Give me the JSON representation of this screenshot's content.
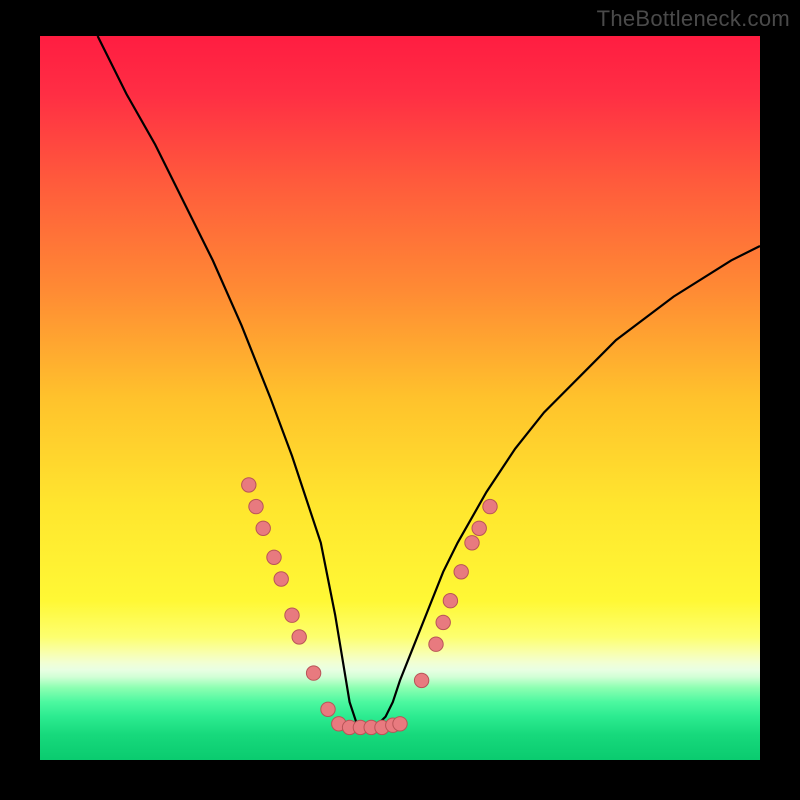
{
  "watermark": "TheBottleneck.com",
  "colors": {
    "gradient_stops": [
      {
        "offset": 0.0,
        "color": "#ff1d41"
      },
      {
        "offset": 0.08,
        "color": "#ff2e44"
      },
      {
        "offset": 0.2,
        "color": "#ff5a3c"
      },
      {
        "offset": 0.35,
        "color": "#ff8a34"
      },
      {
        "offset": 0.5,
        "color": "#ffc22c"
      },
      {
        "offset": 0.65,
        "color": "#ffe62e"
      },
      {
        "offset": 0.78,
        "color": "#fff835"
      },
      {
        "offset": 0.83,
        "color": "#fdff6f"
      },
      {
        "offset": 0.85,
        "color": "#f9ffa8"
      },
      {
        "offset": 0.865,
        "color": "#f2ffd2"
      },
      {
        "offset": 0.875,
        "color": "#e9ffe3"
      },
      {
        "offset": 0.885,
        "color": "#d2ffd6"
      },
      {
        "offset": 0.9,
        "color": "#8dffb2"
      },
      {
        "offset": 0.92,
        "color": "#4cf8a0"
      },
      {
        "offset": 0.94,
        "color": "#2ceb90"
      },
      {
        "offset": 0.965,
        "color": "#17d97c"
      },
      {
        "offset": 1.0,
        "color": "#0acb6f"
      }
    ],
    "curve_stroke": "#000000",
    "dot_fill": "#e87a7f",
    "dot_stroke": "#b85457",
    "frame_black": "#000000"
  },
  "chart_data": {
    "type": "line",
    "title": "",
    "xlabel": "",
    "ylabel": "",
    "x_range": [
      0,
      100
    ],
    "y_range": [
      0,
      100
    ],
    "grid": false,
    "legend": false,
    "notes": "Bottleneck-style V-curve. The y-axis is inverted visually (higher value = higher on screen = worse). Minimum of curve near x≈44. Background is a vertical hue gradient from red (top) to green (bottom). Dots mark sampled hardware points along the curve; flat-bottom dots sit at the optimum.",
    "series": [
      {
        "name": "bottleneck-curve",
        "x": [
          8,
          12,
          16,
          20,
          24,
          28,
          32,
          35,
          37,
          39,
          40,
          41,
          42,
          43,
          44,
          45,
          46,
          47,
          48,
          49,
          50,
          52,
          54,
          56,
          58,
          62,
          66,
          70,
          75,
          80,
          88,
          96,
          100
        ],
        "y": [
          100,
          92,
          85,
          77,
          69,
          60,
          50,
          42,
          36,
          30,
          25,
          20,
          14,
          8,
          5,
          5,
          5,
          5,
          6,
          8,
          11,
          16,
          21,
          26,
          30,
          37,
          43,
          48,
          53,
          58,
          64,
          69,
          71
        ]
      }
    ],
    "dots": {
      "name": "sample-points",
      "points": [
        {
          "x": 29,
          "y": 38
        },
        {
          "x": 30,
          "y": 35
        },
        {
          "x": 31,
          "y": 32
        },
        {
          "x": 32.5,
          "y": 28
        },
        {
          "x": 33.5,
          "y": 25
        },
        {
          "x": 35,
          "y": 20
        },
        {
          "x": 36,
          "y": 17
        },
        {
          "x": 38,
          "y": 12
        },
        {
          "x": 40,
          "y": 7
        },
        {
          "x": 41.5,
          "y": 5
        },
        {
          "x": 43,
          "y": 4.5
        },
        {
          "x": 44.5,
          "y": 4.5
        },
        {
          "x": 46,
          "y": 4.5
        },
        {
          "x": 47.5,
          "y": 4.5
        },
        {
          "x": 49,
          "y": 4.8
        },
        {
          "x": 50,
          "y": 5
        },
        {
          "x": 53,
          "y": 11
        },
        {
          "x": 55,
          "y": 16
        },
        {
          "x": 56,
          "y": 19
        },
        {
          "x": 57,
          "y": 22
        },
        {
          "x": 58.5,
          "y": 26
        },
        {
          "x": 60,
          "y": 30
        },
        {
          "x": 61,
          "y": 32
        },
        {
          "x": 62.5,
          "y": 35
        }
      ]
    }
  }
}
